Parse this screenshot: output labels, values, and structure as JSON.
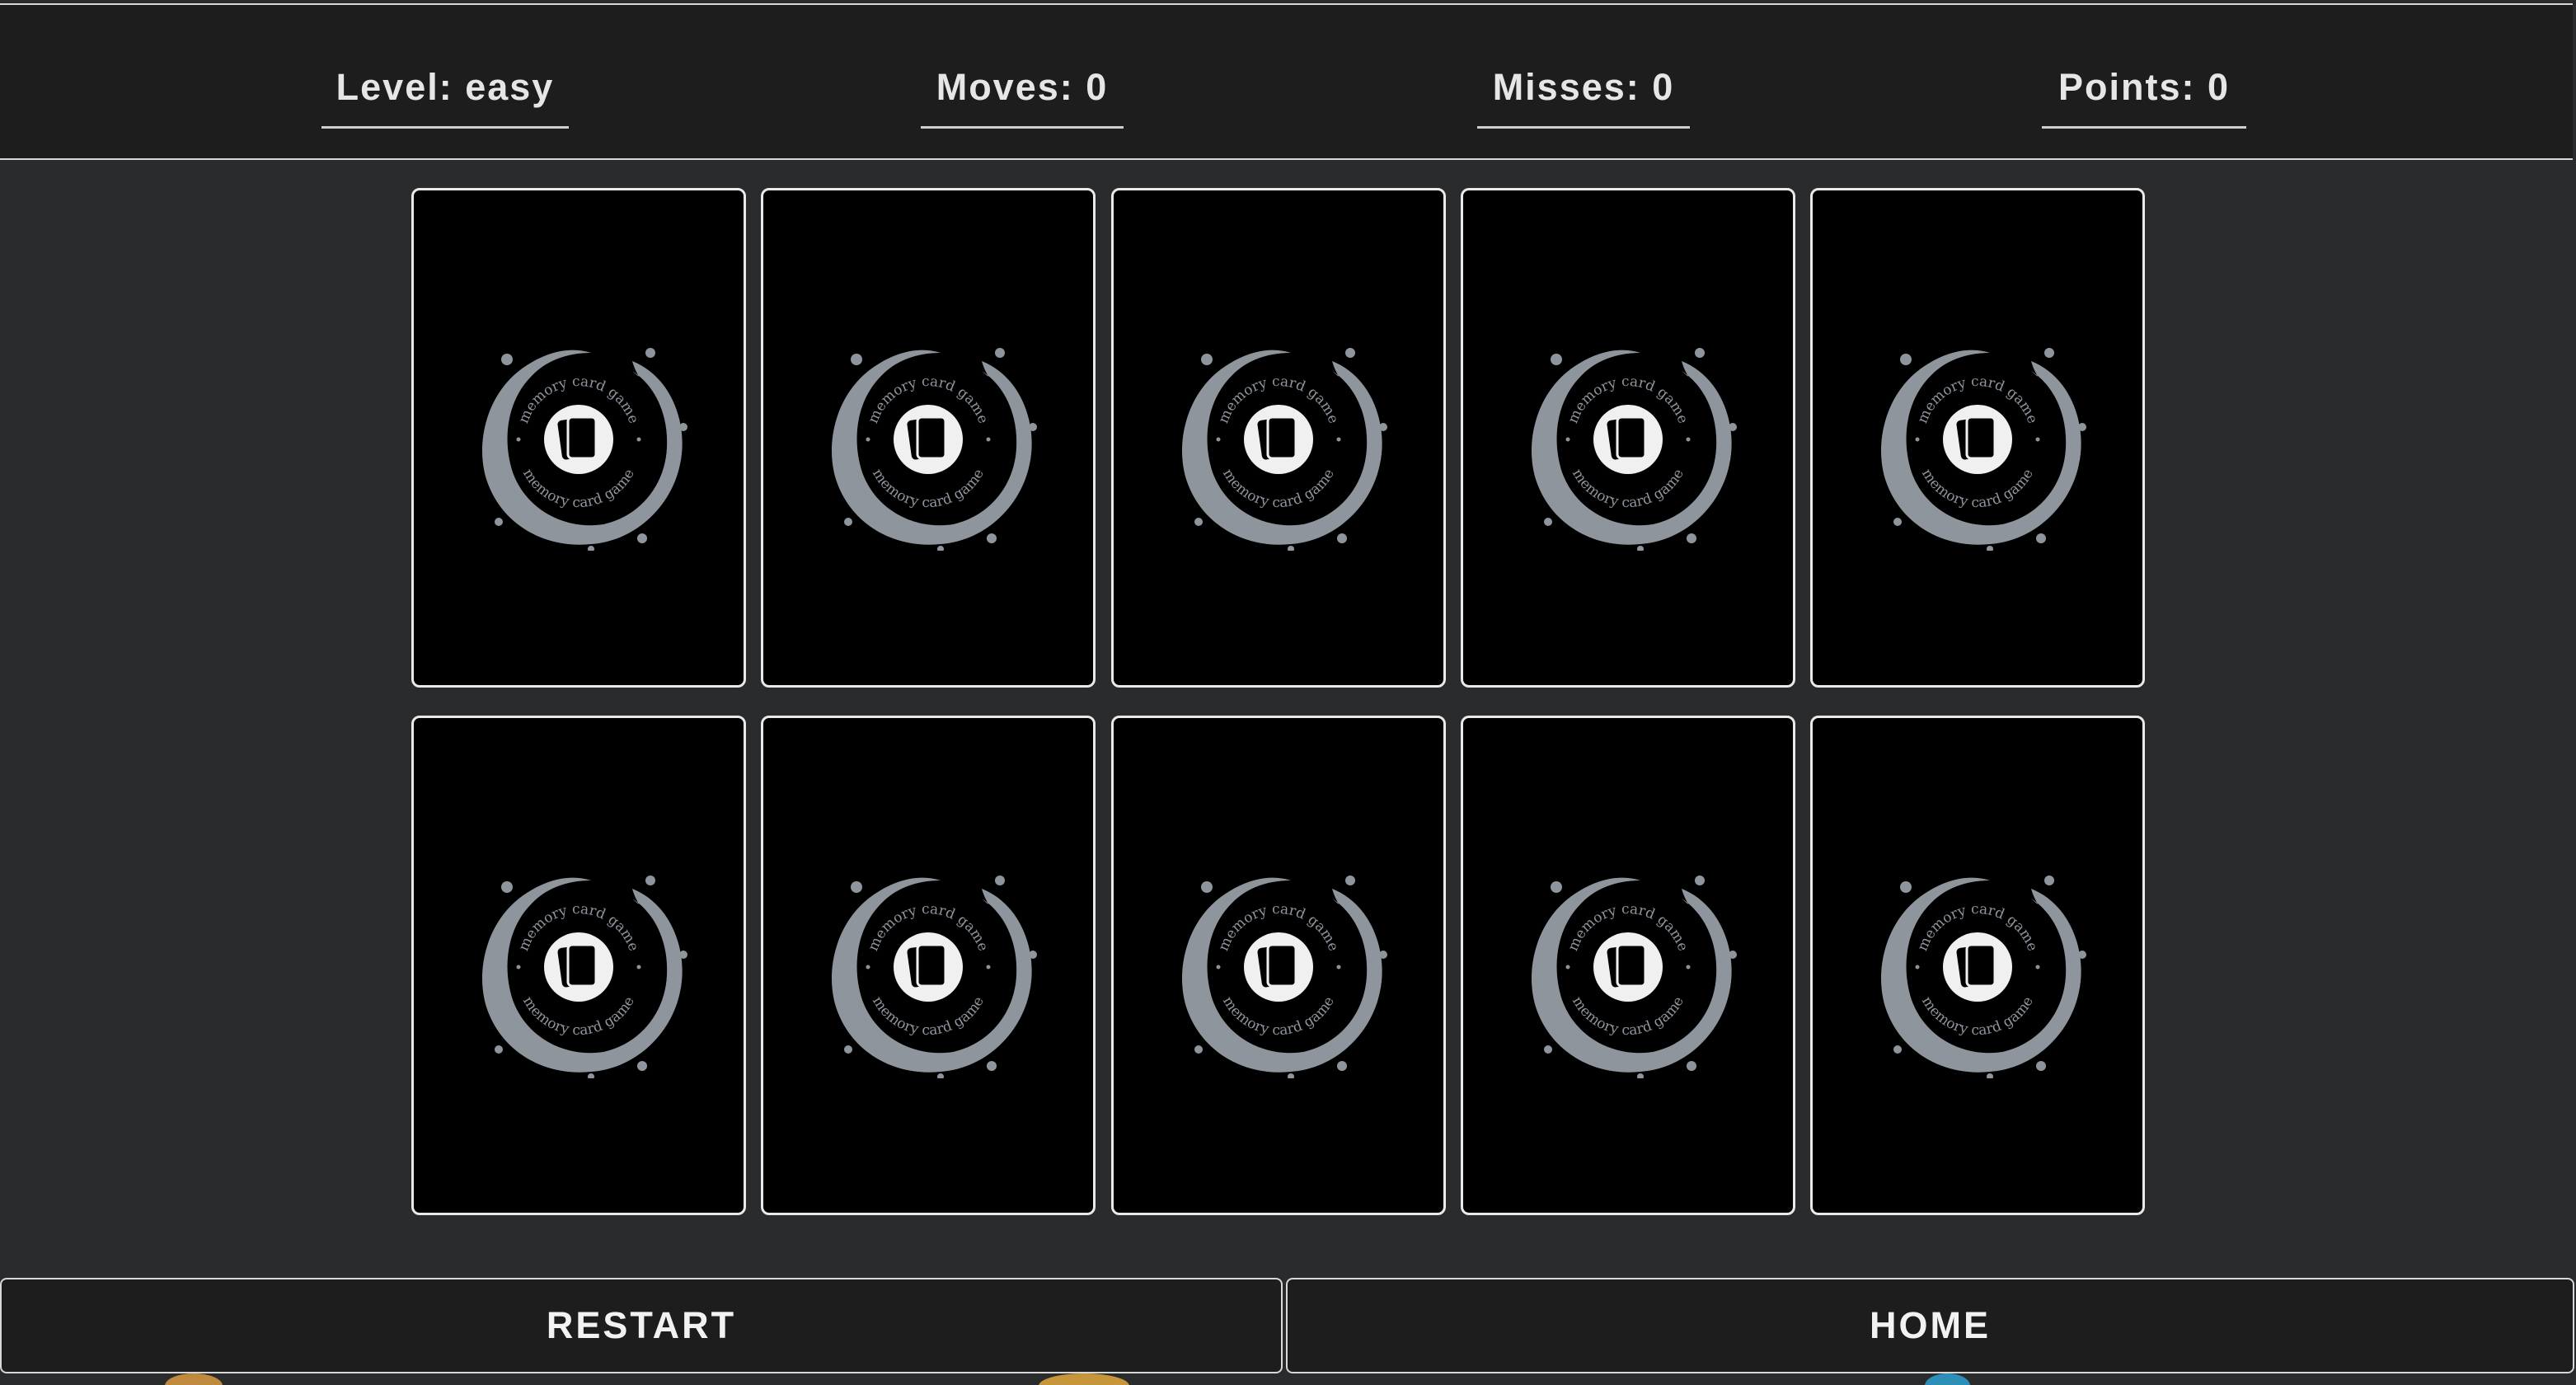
{
  "stats": {
    "level": "Level: easy",
    "moves": "Moves: 0",
    "misses": "Misses: 0",
    "points": "Points: 0"
  },
  "card_back": {
    "logo_text_top": "memory card game",
    "logo_text_bottom": "memory card game",
    "ring_color": "#8e959d",
    "face_down_count": 10
  },
  "buttons": {
    "restart": "RESTART",
    "home": "HOME"
  },
  "colors": {
    "background": "#2a2b2d",
    "bar": "#1d1d1d",
    "card": "#000000",
    "border": "#e9e9e9"
  }
}
